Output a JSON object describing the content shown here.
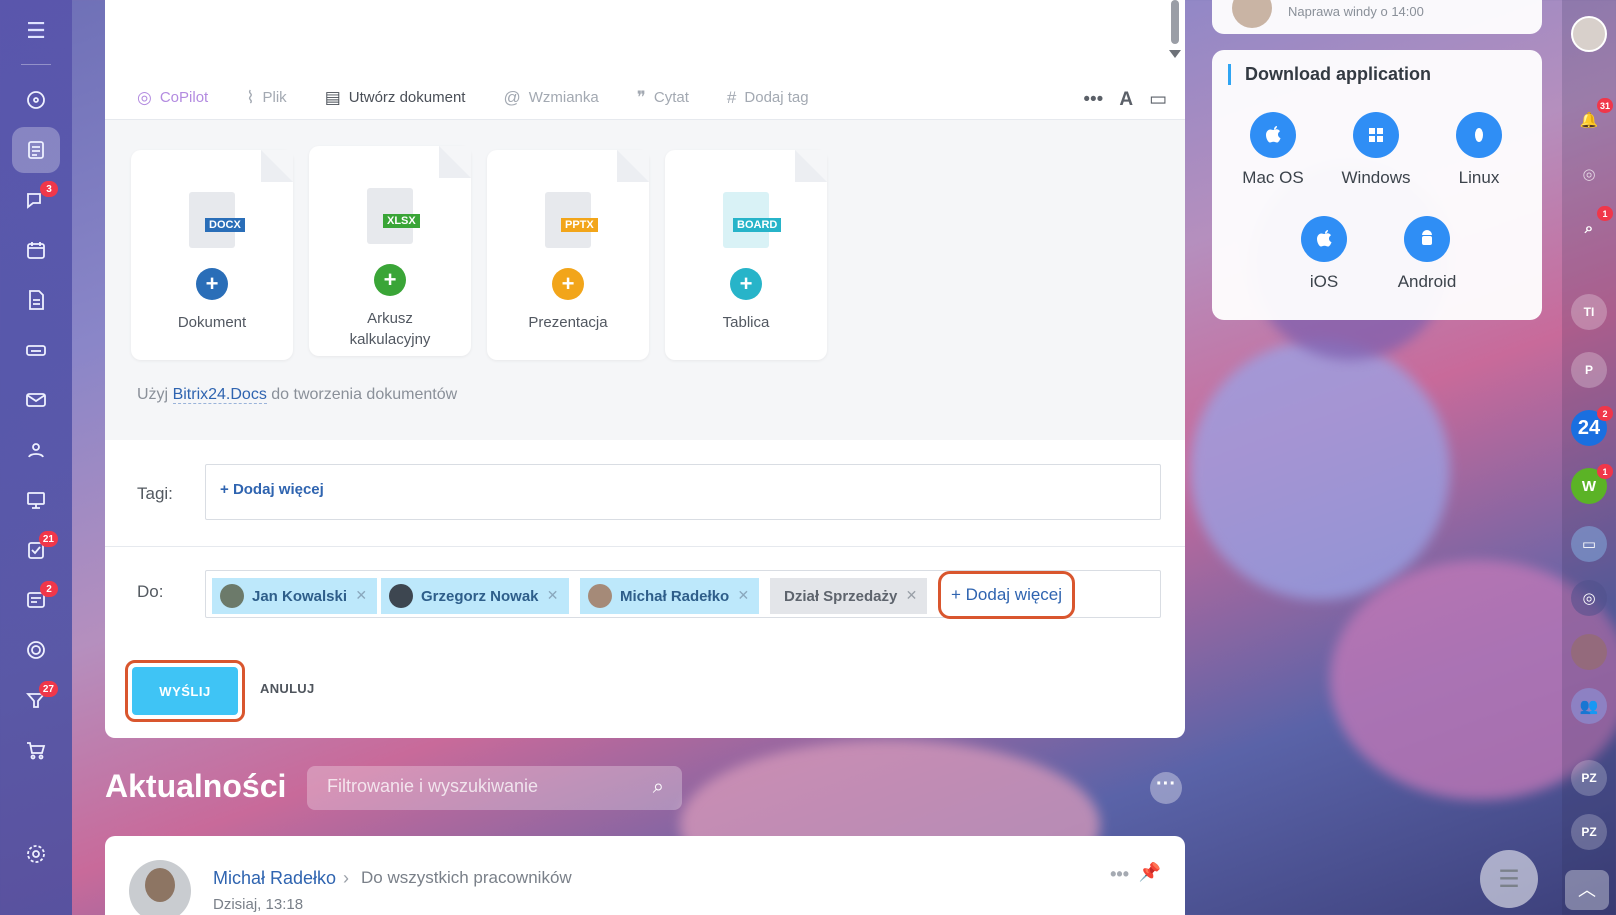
{
  "composer": {
    "toolbar": {
      "copilot": "CoPilot",
      "file": "Plik",
      "create_doc": "Utwórz dokument",
      "mention": "Wzmianka",
      "quote": "Cytat",
      "add_tag": "Dodaj tag"
    },
    "docs": [
      {
        "label": "Dokument",
        "tag": "DOCX",
        "color": "#2a6eb8"
      },
      {
        "label": "Arkusz kalkulacyjny",
        "tag": "XLSX",
        "color": "#3aa537"
      },
      {
        "label": "Prezentacja",
        "tag": "PPTX",
        "color": "#f2a51a"
      },
      {
        "label": "Tablica",
        "tag": "BOARD",
        "color": "#27b4c9"
      }
    ],
    "hint_prefix": "Użyj",
    "hint_link": "Bitrix24.Docs",
    "hint_suffix": "do tworzenia dokumentów",
    "tags_label": "Tagi:",
    "tags_add": "Dodaj więcej",
    "to_label": "Do:",
    "recipients": [
      "Jan Kowalski",
      "Grzegorz Nowak",
      "Michał Radełko",
      "Dział Sprzedaży"
    ],
    "to_add": "Dodaj więcej",
    "send": "WYŚLIJ",
    "cancel": "ANULUJ"
  },
  "feed": {
    "title": "Aktualności",
    "search_placeholder": "Filtrowanie i wyszukiwanie",
    "post": {
      "author": "Michał Radełko",
      "target": "Do wszystkich pracowników",
      "time": "Dzisiaj, 13:18"
    }
  },
  "widget": {
    "top_text": "Naprawa windy o 14:00",
    "title": "Download application",
    "apps": [
      "Mac OS",
      "Windows",
      "Linux",
      "iOS",
      "Android"
    ]
  },
  "left_nav": {
    "badges": {
      "chat": "3",
      "tasks": "21",
      "feed": "2",
      "crm": "27"
    }
  },
  "right_bar": {
    "notifications_badge": "31",
    "chat_badge": "1",
    "b24_label": "24",
    "b24_badge": "2",
    "w_label": "W",
    "w_badge": "1",
    "ti_label": "TI",
    "p_label": "P",
    "pz1_label": "PZ",
    "pz2_label": "PZ"
  },
  "colors": {
    "accent": "#3fc4f5",
    "highlight": "#d9562e",
    "link": "#2f64b0"
  }
}
